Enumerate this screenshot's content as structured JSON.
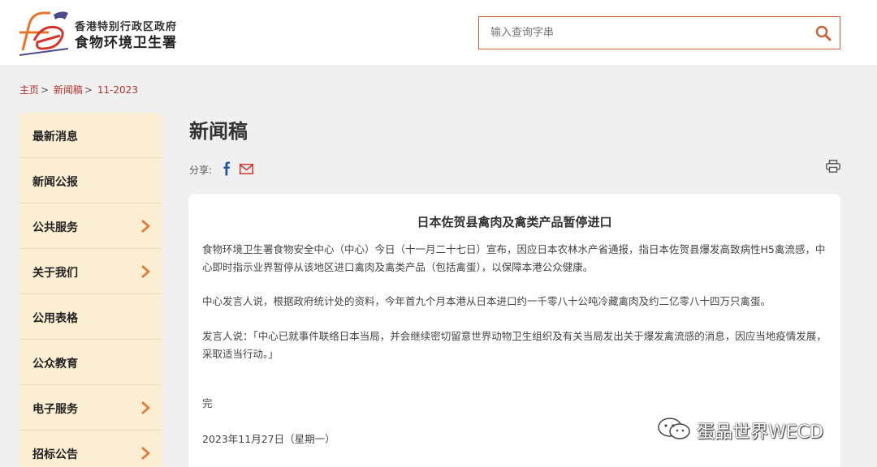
{
  "header": {
    "org_line1": "香港特别行政区政府",
    "org_line2": "食物环境卫生署",
    "search_placeholder": "输入查询字串",
    "accent_color": "#c8643c"
  },
  "breadcrumb": [
    {
      "label": "主页"
    },
    {
      "label": "新闻稿"
    },
    {
      "label": "11-2023"
    }
  ],
  "sidebar": {
    "items": [
      {
        "label": "最新消息",
        "has_arrow": false
      },
      {
        "label": "新闻公报",
        "has_arrow": false
      },
      {
        "label": "公共服务",
        "has_arrow": true
      },
      {
        "label": "关于我们",
        "has_arrow": true
      },
      {
        "label": "公用表格",
        "has_arrow": false
      },
      {
        "label": "公众教育",
        "has_arrow": false
      },
      {
        "label": "电子服务",
        "has_arrow": true
      },
      {
        "label": "招标公告",
        "has_arrow": true
      }
    ]
  },
  "main": {
    "title": "新闻稿",
    "share_label": "分享:",
    "article": {
      "title": "日本佐贺县禽肉及禽类产品暂停进口",
      "paragraphs": [
        "食物环境卫生署食物安全中心（中心）今日（十一月二十七日）宣布，因应日本农林水产省通报，指日本佐贺县爆发高致病性H5禽流感，中心即时指示业界暂停从该地区进口禽肉及禽类产品（包括禽蛋），以保障本港公众健康。",
        "中心发言人说，根据政府统计处的资料，今年首九个月本港从日本进口约一千零八十公吨冷藏禽肉及约二亿零八十四万只禽蛋。",
        "发言人说：「中心已就事件联络日本当局，并会继续密切留意世界动物卫生组织及有关当局发出关于爆发禽流感的消息，因应当地疫情发展，采取适当行动。」",
        "完",
        "2023年11月27日（星期一）"
      ]
    }
  },
  "watermark": {
    "text": "蛋品世界WECD"
  }
}
